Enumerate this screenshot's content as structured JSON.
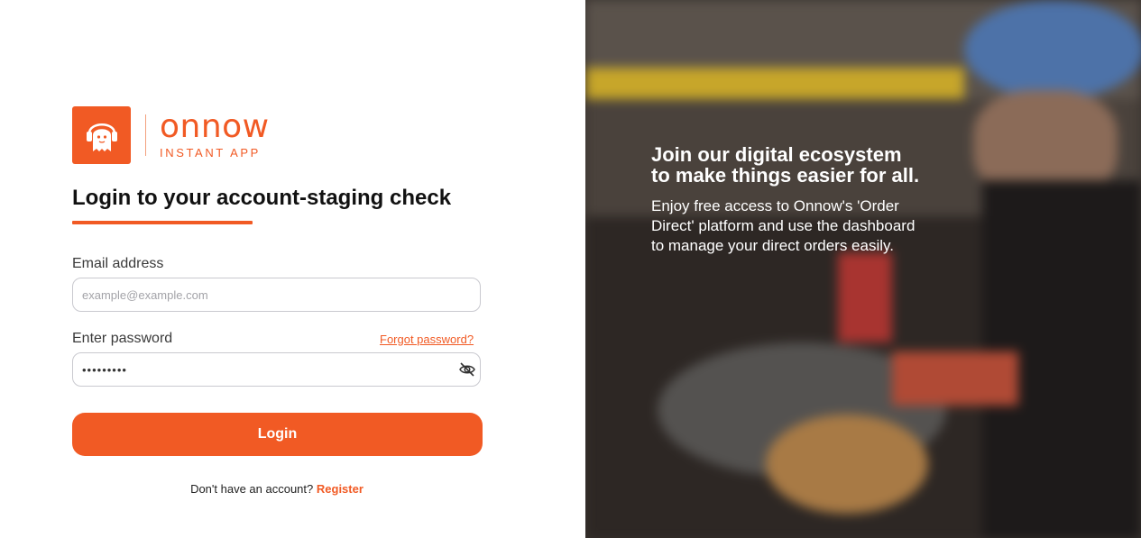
{
  "brand": {
    "name": "onnow",
    "tagline": "INSTANT APP",
    "primary_color": "#f15a24",
    "logo_icon": "ghost-headphones-icon"
  },
  "login": {
    "title": "Login to your account-staging check",
    "email_label": "Email address",
    "email_placeholder": "example@example.com",
    "email_value": "",
    "password_label": "Enter password",
    "password_value": "•••••••••",
    "forgot_link": "Forgot password?",
    "toggle_icon": "eye-slash-icon",
    "submit_label": "Login",
    "signup_prompt": "Don't have an account?",
    "register_link": "Register"
  },
  "promo": {
    "heading": "Join our digital ecosystem to make things easier for all.",
    "body": "Enjoy free access to Onnow's 'Order Direct' platform and use the dashboard to manage your direct orders easily."
  }
}
